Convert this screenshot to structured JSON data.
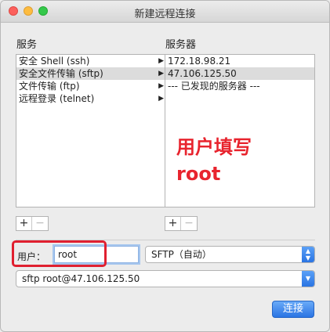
{
  "window": {
    "title": "新建远程连接"
  },
  "services": {
    "header": "服务",
    "items": [
      {
        "label": "安全 Shell (ssh)",
        "selected": false
      },
      {
        "label": "安全文件传输 (sftp)",
        "selected": true
      },
      {
        "label": "文件传输 (ftp)",
        "selected": false
      },
      {
        "label": "远程登录 (telnet)",
        "selected": false
      }
    ]
  },
  "servers": {
    "header": "服务器",
    "items": [
      {
        "label": "172.18.98.21",
        "selected": false
      },
      {
        "label": "47.106.125.50",
        "selected": true
      },
      {
        "label": "--- 已发现的服务器 ---",
        "selected": false
      }
    ]
  },
  "annotation": {
    "line1": "用户填写",
    "line2": "root",
    "color": "#e8242e"
  },
  "buttons": {
    "add": "+",
    "remove": "−",
    "connect": "连接"
  },
  "user": {
    "label": "用户：",
    "value": "root"
  },
  "protocol": {
    "selected": "SFTP（自动）"
  },
  "command": {
    "value": "sftp root@47.106.125.50"
  },
  "icons": {
    "arrow": "▶",
    "stepper": "⇅"
  },
  "colors": {
    "accent": "#2a74e3",
    "highlight_box": "#e02030"
  }
}
